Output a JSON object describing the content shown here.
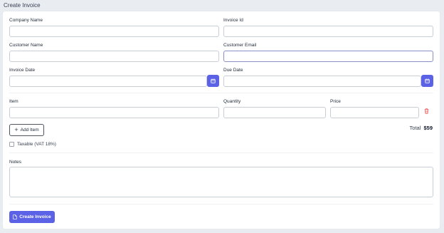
{
  "page": {
    "title": "Create Invoice"
  },
  "fields": {
    "company_name": {
      "label": "Company Name",
      "value": "",
      "placeholder": ""
    },
    "invoice_id": {
      "label": "Invoice Id",
      "value": "",
      "placeholder": ""
    },
    "customer_name": {
      "label": "Customer Name",
      "value": "",
      "placeholder": ""
    },
    "customer_email": {
      "label": "Customer Email",
      "value": "",
      "placeholder": ""
    },
    "invoice_date": {
      "label": "Invoice Date",
      "value": "",
      "placeholder": ""
    },
    "due_date": {
      "label": "Due Date",
      "value": "",
      "placeholder": ""
    }
  },
  "items": {
    "headers": {
      "item": "Item",
      "quantity": "Quantity",
      "price": "Price"
    },
    "rows": [
      {
        "item": "",
        "quantity": "",
        "price": ""
      }
    ],
    "add_label": "Add Item"
  },
  "total": {
    "label": "Total",
    "value": "$59"
  },
  "taxable": {
    "label": "Taxable (VAT 18%)",
    "checked": false
  },
  "notes": {
    "label": "Notes",
    "value": ""
  },
  "submit": {
    "label": "Create Invoice"
  },
  "colors": {
    "accent": "#5b62e6",
    "danger": "#ef4444",
    "background": "#e9edf2"
  },
  "icons": {
    "calendar": "calendar-icon",
    "plus": "plus-icon",
    "trash": "trash-icon",
    "document": "document-icon"
  }
}
